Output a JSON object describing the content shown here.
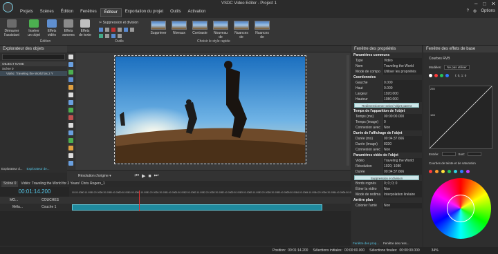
{
  "window": {
    "title": "VSDC Video Editor - Project 1",
    "options_label": "Options"
  },
  "menu": [
    "Projets",
    "Scènes",
    "Édition",
    "Fenêtres",
    "Éditeur",
    "Exportation du projet",
    "Outils",
    "Activation"
  ],
  "menu_active_index": 4,
  "ribbon": {
    "buttons": [
      {
        "label": "Démarrer\nl'assistant",
        "color": "#6b6b6b"
      },
      {
        "label": "Insérer\nun objet",
        "color": "#4caf50"
      },
      {
        "label": "Effets\nvidéo",
        "color": "#5f8fd0"
      },
      {
        "label": "Effets\nsonores",
        "color": "#8a8a8a"
      },
      {
        "label": "Effets\nde texte",
        "color": "#c0c0c0"
      }
    ],
    "cut_label": "Suppression et division",
    "group_edition": "Édition",
    "group_tools": "Outils",
    "group_style": "Choisir le style rapide",
    "styles": [
      "Supprimer",
      "Niveaux",
      "Contraste",
      "Nouveau de",
      "Nuances de",
      "Nuances de"
    ]
  },
  "left_panel": {
    "title": "Explorateur des objets",
    "column_header": "OBJECT NAME",
    "items": [
      "Scène 0",
      "Vidéo: Traveling the World fas 2 Y"
    ],
    "tabs": [
      "Explorateur d...",
      "Explorateur de..."
    ]
  },
  "preview_toolbar": {
    "resolution": "Résolution d'origine"
  },
  "timeline": {
    "scene_tab": "Scène 0",
    "clip_tab": "Vidéo: Traveling the World for 2 Years! Chris Rogers_1",
    "playhead_time": "00:01:14.200",
    "ruler_ticks": [
      "00:00.000",
      "00:10.000",
      "00:20.000",
      "00:30.000",
      "00:40.000",
      "00:50.000",
      "01:00.000",
      "01:10.000",
      "01:20.000",
      "01:30.000",
      "01:40.000",
      "01:50.000",
      "02:00.000",
      "02:10.000",
      "02:20.000",
      "02:30.000",
      "02:40.000",
      "02:50.000",
      "03:00.000",
      "03:10.000",
      "03:20.000",
      "03:30.000",
      "03:40.000",
      "03:50.000",
      "04:00.000",
      "04:10.000",
      "04:20.000",
      "04:30.000",
      "04:40.000",
      "04:50.000"
    ],
    "track_headers": [
      "MO...",
      "COUCHES"
    ],
    "track_rows": [
      {
        "name": "Méla...",
        "layer": "Couche 1"
      }
    ]
  },
  "properties": {
    "title": "Fenêtre des propriétés",
    "rows": [
      {
        "type": "sec",
        "k": "Paramètres communs"
      },
      {
        "type": "row",
        "k": "Type",
        "v": "Vidéo"
      },
      {
        "type": "row",
        "k": "Nom",
        "v": "Traveling the World"
      },
      {
        "type": "row",
        "k": "Mode de compo",
        "v": "Utiliser les propriétés"
      },
      {
        "type": "sec",
        "k": "Coordonnées"
      },
      {
        "type": "row",
        "k": "Gauche",
        "v": "0.000"
      },
      {
        "type": "row",
        "k": "Haut",
        "v": "0.000"
      },
      {
        "type": "row",
        "k": "Largeur",
        "v": "1920.000"
      },
      {
        "type": "row",
        "k": "Hauteur",
        "v": "1080.000"
      },
      {
        "type": "btn",
        "k": "Redimensionner selon l'objet parent"
      },
      {
        "type": "sec",
        "k": "Temps de l'apparition de l'objet"
      },
      {
        "type": "row",
        "k": "Temps (ms)",
        "v": "00:00:00.000"
      },
      {
        "type": "row",
        "k": "Temps (image)",
        "v": "0"
      },
      {
        "type": "row",
        "k": "Connexion avec",
        "v": "Non"
      },
      {
        "type": "sec",
        "k": "Durée de l'affichage de l'objet"
      },
      {
        "type": "row",
        "k": "Durée (ms)",
        "v": "00:04:37.666"
      },
      {
        "type": "row",
        "k": "Durée (image)",
        "v": "8330"
      },
      {
        "type": "row",
        "k": "Connexion avec",
        "v": "Non"
      },
      {
        "type": "sec",
        "k": "Paramètres vidéo de l'objet"
      },
      {
        "type": "row",
        "k": "Vidéo",
        "v": "Traveling the World"
      },
      {
        "type": "row",
        "k": "Résolution",
        "v": "1920; 1080"
      },
      {
        "type": "row",
        "k": "Durée",
        "v": "00:04:37.666"
      },
      {
        "type": "btn",
        "k": "Suppression et division"
      },
      {
        "type": "row",
        "k": "Bords rognés",
        "v": "0; 0; 0; 0"
      },
      {
        "type": "row",
        "k": "Étirer la vidéo",
        "v": "Non"
      },
      {
        "type": "row",
        "k": "Mode de redima",
        "v": "Interpolation linéaire"
      },
      {
        "type": "sec",
        "k": "Arrière plan"
      },
      {
        "type": "row",
        "k": "Colorier l'arriè",
        "v": "Non"
      }
    ],
    "bottom_tabs": [
      "Fenêtre des prop...",
      "Fenêtre des ress..."
    ]
  },
  "effects": {
    "title": "Fenêtre des effets de base",
    "rgb_section": "Courbes RVB",
    "mode_label": "Modèles:",
    "mode_value": "Ne pas utiliser",
    "point_label": "t: 0, 1: 0",
    "y_ticks": [
      "255",
      "128"
    ],
    "entry_label": "Entrée:",
    "exit_label": "Sort:",
    "hue_section": "Courbes de teinte et de saturation",
    "dot_colors": [
      "#ffffff",
      "#ff3b3b",
      "#27c25a",
      "#2f7bff"
    ],
    "hue_dot_colors": [
      "#ff3b3b",
      "#ff9a2e",
      "#ffe23b",
      "#27c25a",
      "#2fd0e0",
      "#2f7bff",
      "#c03bff"
    ]
  },
  "status": {
    "position_label": "Position:",
    "position_value": "00:01:14.200",
    "start_label": "Sélections initiales:",
    "start_value": "00:00:00.000",
    "end_label": "Sélections finales:",
    "end_value": "00:00:00.000",
    "zoom": "34%"
  }
}
